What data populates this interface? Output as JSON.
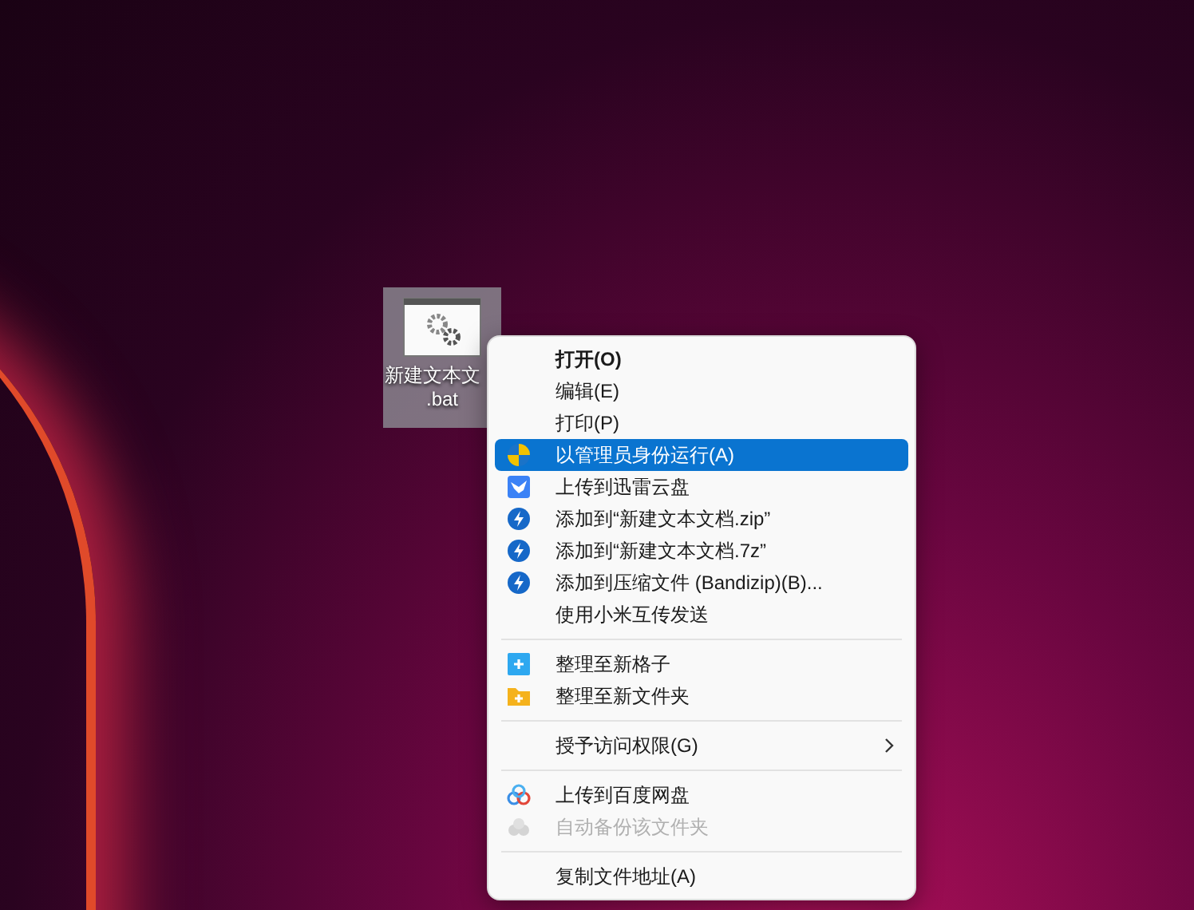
{
  "desktop_icon": {
    "label": "新建文本文",
    "extension": ".bat",
    "selected": true
  },
  "context_menu": {
    "items": [
      {
        "kind": "item",
        "label": "打开(O)",
        "bold": true,
        "selected": false,
        "disabled": false
      },
      {
        "kind": "item",
        "label": "编辑(E)",
        "selected": false,
        "disabled": false
      },
      {
        "kind": "item",
        "label": "打印(P)",
        "selected": false,
        "disabled": false
      },
      {
        "kind": "item",
        "label": "以管理员身份运行(A)",
        "selected": true,
        "disabled": false
      },
      {
        "kind": "item",
        "label": "上传到迅雷云盘",
        "selected": false,
        "disabled": false
      },
      {
        "kind": "item",
        "label": "添加到“新建文本文档.zip”",
        "selected": false,
        "disabled": false
      },
      {
        "kind": "item",
        "label": "添加到“新建文本文档.7z”",
        "selected": false,
        "disabled": false
      },
      {
        "kind": "item",
        "label": "添加到压缩文件 (Bandizip)(B)...",
        "selected": false,
        "disabled": false
      },
      {
        "kind": "item",
        "label": "使用小米互传发送",
        "selected": false,
        "disabled": false
      },
      {
        "kind": "separator"
      },
      {
        "kind": "item",
        "label": "整理至新格子",
        "selected": false,
        "disabled": false
      },
      {
        "kind": "item",
        "label": "整理至新文件夹",
        "selected": false,
        "disabled": false
      },
      {
        "kind": "separator"
      },
      {
        "kind": "item",
        "label": "授予访问权限(G)",
        "submenu": true,
        "selected": false,
        "disabled": false
      },
      {
        "kind": "separator"
      },
      {
        "kind": "item",
        "label": "上传到百度网盘",
        "selected": false,
        "disabled": false
      },
      {
        "kind": "item",
        "label": "自动备份该文件夹",
        "selected": false,
        "disabled": true
      },
      {
        "kind": "separator"
      },
      {
        "kind": "item",
        "label": "复制文件地址(A)",
        "selected": false,
        "disabled": false
      }
    ]
  }
}
